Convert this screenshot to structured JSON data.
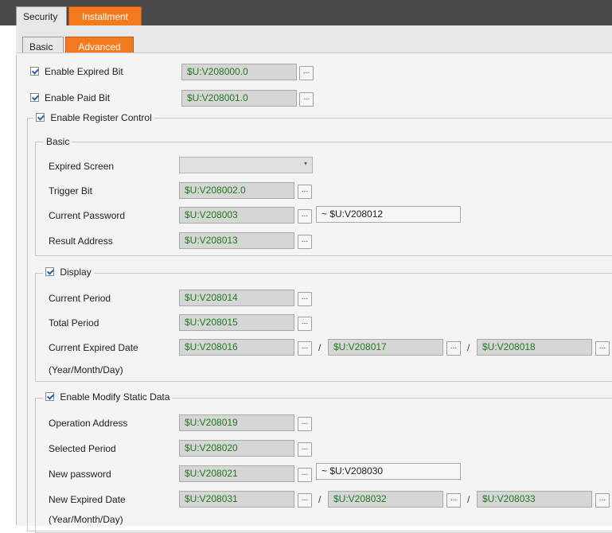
{
  "tabs": {
    "security": "Security",
    "installment": "Installment"
  },
  "subtabs": {
    "basic": "Basic",
    "advanced": "Advanced"
  },
  "top": {
    "enable_expired_bit": {
      "label": "Enable Expired Bit",
      "value": "$U:V208000.0"
    },
    "enable_paid_bit": {
      "label": "Enable Paid Bit",
      "value": "$U:V208001.0"
    }
  },
  "register_control": {
    "title": "Enable Register Control",
    "basic": {
      "title": "Basic",
      "expired_screen": {
        "label": "Expired Screen",
        "value": ""
      },
      "trigger_bit": {
        "label": "Trigger Bit",
        "value": "$U:V208002.0"
      },
      "current_password": {
        "label": "Current Password",
        "value": "$U:V208003",
        "range": "~ $U:V208012"
      },
      "result_address": {
        "label": "Result Address",
        "value": "$U:V208013"
      }
    },
    "display": {
      "title": "Display",
      "current_period": {
        "label": "Current Period",
        "value": "$U:V208014"
      },
      "total_period": {
        "label": "Total Period",
        "value": "$U:V208015"
      },
      "current_expired_date": {
        "label": "Current Expired Date",
        "sub": "(Year/Month/Day)",
        "year": "$U:V208016",
        "month": "$U:V208017",
        "day": "$U:V208018"
      }
    },
    "modify": {
      "title": "Enable Modify Static Data",
      "operation_address": {
        "label": "Operation Address",
        "value": "$U:V208019"
      },
      "selected_period": {
        "label": "Selected Period",
        "value": "$U:V208020"
      },
      "new_password": {
        "label": "New password",
        "value": "$U:V208021",
        "range": "~ $U:V208030"
      },
      "new_expired_date": {
        "label": "New Expired Date",
        "sub": "(Year/Month/Day)",
        "year": "$U:V208031",
        "month": "$U:V208032",
        "day": "$U:V208033"
      }
    }
  },
  "common": {
    "browse": "...",
    "slash": "/",
    "dropdown_arrow": "▾"
  },
  "colors": {
    "accent": "#f47a20",
    "value_text": "#1f7a1f"
  }
}
